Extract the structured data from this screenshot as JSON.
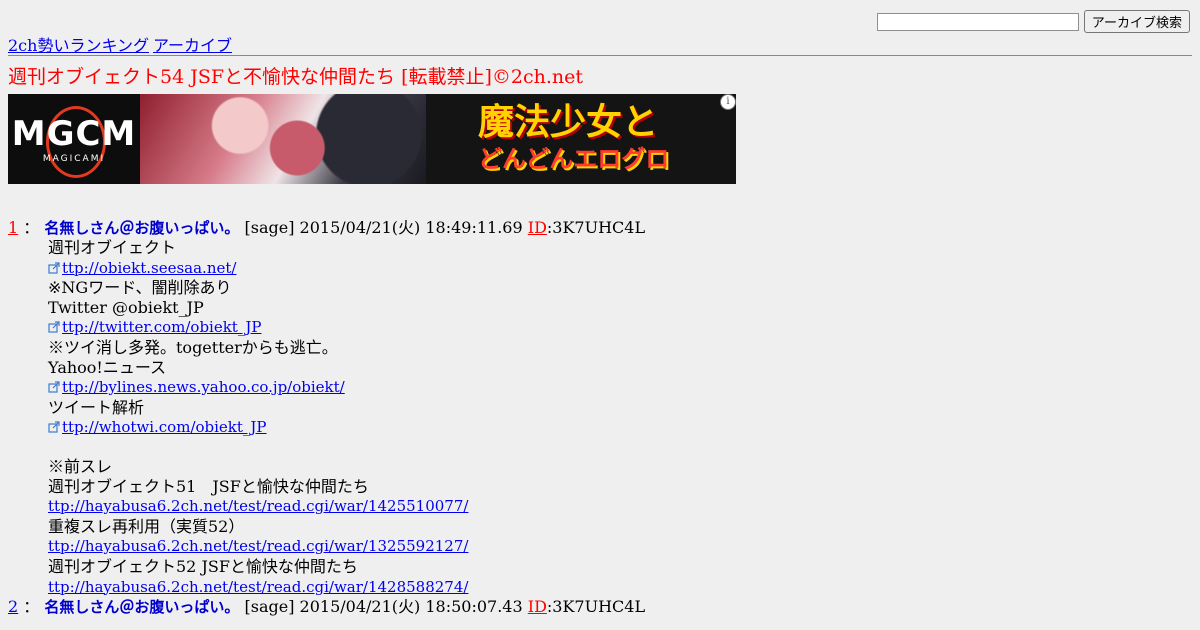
{
  "nav": {
    "ranking_link": "2ch勢いランキング",
    "archive_link": "アーカイブ"
  },
  "search": {
    "value": "",
    "button_label": "アーカイブ検索"
  },
  "thread": {
    "title": "週刊オブイェクト54 JSFと不愉快な仲間たち [転載禁止]©2ch.net"
  },
  "ad": {
    "logo_text": "MGCM",
    "logo_sub": "MAGICAMI",
    "headline_1": "魔法少女と",
    "headline_2": "どんどんエログロ",
    "info_icon": "i"
  },
  "posts": [
    {
      "number": "1",
      "separator": "：",
      "name": "名無しさん＠お腹いっぱい。",
      "mail": "[sage]",
      "date": "2015/04/21(火) 18:49:11.69",
      "id_label": "ID",
      "id_value": ":3K7UHC4L",
      "lines": [
        {
          "type": "text",
          "text": "週刊オブイェクト"
        },
        {
          "type": "link",
          "text": "ttp://obiekt.seesaa.net/",
          "icon": "external-link-icon"
        },
        {
          "type": "text",
          "text": "※NGワード、闇削除あり"
        },
        {
          "type": "text",
          "text": "Twitter @obiekt_JP"
        },
        {
          "type": "link",
          "text": "ttp://twitter.com/obiekt_JP",
          "icon": "external-link-icon"
        },
        {
          "type": "text",
          "text": "※ツイ消し多発。togetterからも逃亡。"
        },
        {
          "type": "text",
          "text": "Yahoo!ニュース"
        },
        {
          "type": "link",
          "text": "ttp://bylines.news.yahoo.co.jp/obiekt/",
          "icon": "external-link-icon"
        },
        {
          "type": "text",
          "text": "ツイート解析"
        },
        {
          "type": "link",
          "text": "ttp://whotwi.com/obiekt_JP",
          "icon": "external-link-icon"
        },
        {
          "type": "blank",
          "text": ""
        },
        {
          "type": "text",
          "text": "※前スレ"
        },
        {
          "type": "text",
          "text": "週刊オブイェクト51　JSFと愉快な仲間たち"
        },
        {
          "type": "plainlink",
          "text": "ttp://hayabusa6.2ch.net/test/read.cgi/war/1425510077/"
        },
        {
          "type": "text",
          "text": "重複スレ再利用（実質52）"
        },
        {
          "type": "plainlink",
          "text": "ttp://hayabusa6.2ch.net/test/read.cgi/war/1325592127/"
        },
        {
          "type": "text",
          "text": "週刊オブイェクト52 JSFと愉快な仲間たち"
        },
        {
          "type": "plainlink",
          "text": "ttp://hayabusa6.2ch.net/test/read.cgi/war/1428588274/"
        }
      ]
    },
    {
      "number": "2",
      "separator": "：",
      "name": "名無しさん＠お腹いっぱい。",
      "mail": "[sage]",
      "date": "2015/04/21(火) 18:50:07.43",
      "id_label": "ID",
      "id_value": ":3K7UHC4L",
      "lines": []
    }
  ]
}
